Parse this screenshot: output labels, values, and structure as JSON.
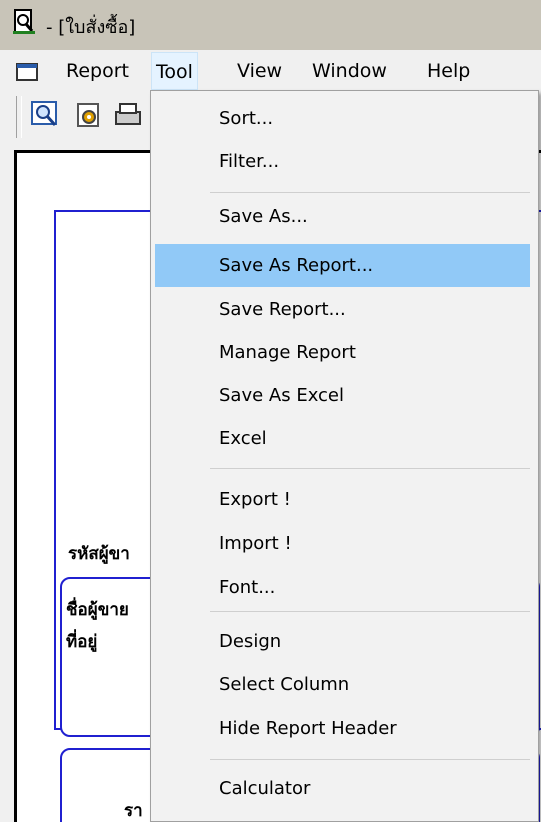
{
  "window": {
    "title": "- [ใบสั่งซื้อ]"
  },
  "menubar": {
    "items": [
      {
        "label": "Report"
      },
      {
        "label": "Tool"
      },
      {
        "label": "View"
      },
      {
        "label": "Window"
      },
      {
        "label": "Help"
      }
    ],
    "active": "Tool"
  },
  "toolbar": {
    "icons": [
      "preview-icon",
      "settings-icon",
      "print-icon"
    ]
  },
  "background": {
    "supplier_code_label": "รหัสผู้ขา",
    "supplier_name_label": "ชื่อผู้ขาย",
    "address_label": "ที่อยู่",
    "partial_label": "รา"
  },
  "tool_menu": {
    "highlighted": "Save As Report...",
    "items": [
      {
        "label": "Sort..."
      },
      {
        "label": "Filter..."
      },
      {
        "label": "Save As..."
      },
      {
        "label": "Save As Report..."
      },
      {
        "label": "Save Report..."
      },
      {
        "label": "Manage Report"
      },
      {
        "label": "Save As Excel"
      },
      {
        "label": "Excel"
      },
      {
        "label": "Export !"
      },
      {
        "label": "Import !"
      },
      {
        "label": "Font..."
      },
      {
        "label": "Design"
      },
      {
        "label": "Select Column"
      },
      {
        "label": "Hide Report Header"
      },
      {
        "label": "Calculator"
      }
    ]
  },
  "colors": {
    "highlight": "#91c9f7",
    "report_border": "#2020d0",
    "title_bar": "#c8c4b8"
  }
}
